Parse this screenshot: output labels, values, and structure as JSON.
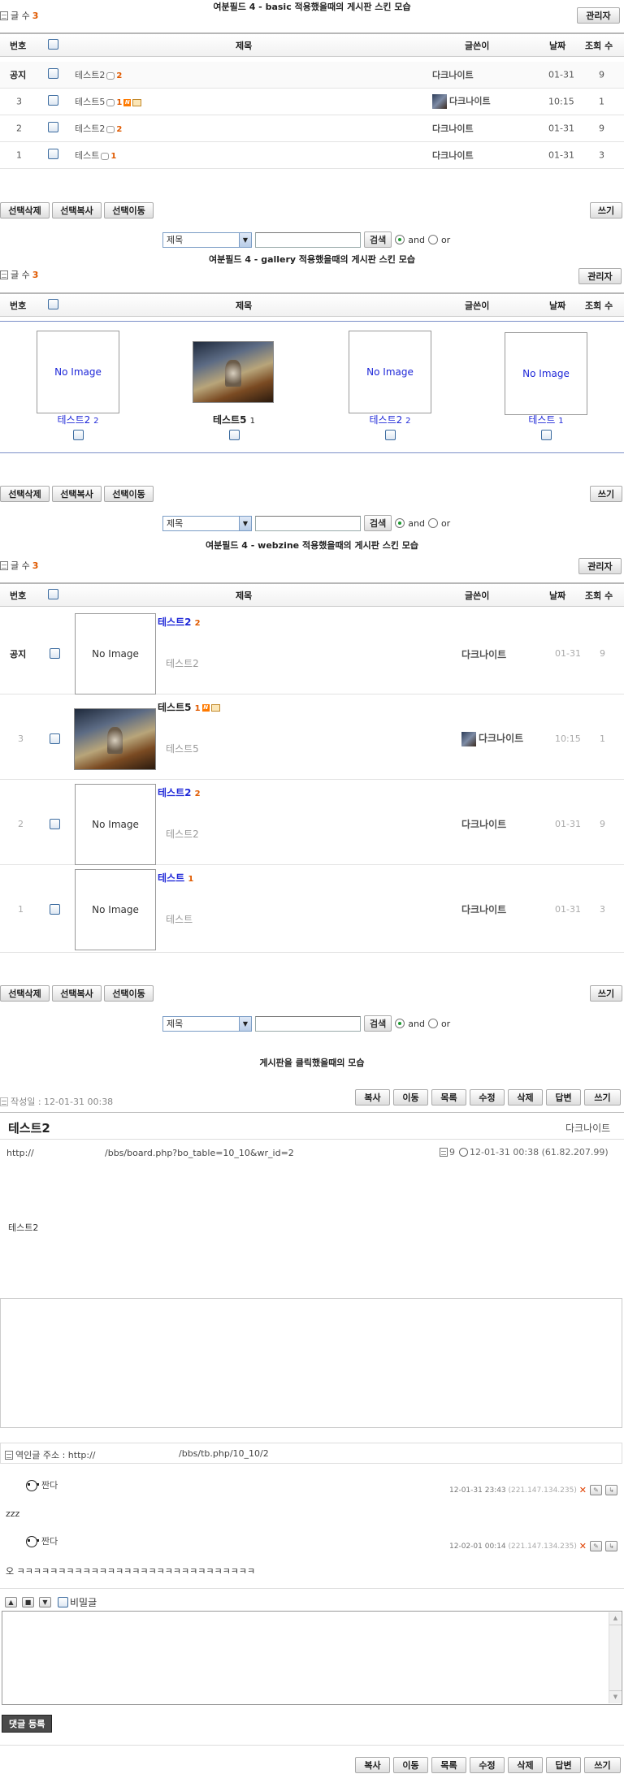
{
  "basic": {
    "title": "여분필드 4 - basic 적용했을때의 게시판 스킨 모습",
    "count_label": "글 수",
    "count": "3",
    "admin_btn": "관리자",
    "headers": {
      "no": "번호",
      "subject": "제목",
      "writer": "글쓴이",
      "date": "날짜",
      "hits": "조회 수"
    },
    "rows": [
      {
        "no": "공지",
        "subject": "테스트2",
        "comments": "2",
        "writer": "다크나이트",
        "date": "01-31",
        "hits": "9"
      },
      {
        "no": "3",
        "subject": "테스트5",
        "comments": "1",
        "writer": "다크나이트",
        "date": "10:15",
        "hits": "1"
      },
      {
        "no": "2",
        "subject": "테스트2",
        "comments": "2",
        "writer": "다크나이트",
        "date": "01-31",
        "hits": "9"
      },
      {
        "no": "1",
        "subject": "테스트",
        "comments": "1",
        "writer": "다크나이트",
        "date": "01-31",
        "hits": "3"
      }
    ]
  },
  "actions": {
    "delete": "선택삭제",
    "copy": "선택복사",
    "move": "선택이동",
    "write": "쓰기"
  },
  "search": {
    "field": "제목",
    "button": "검색",
    "and": "and",
    "or": "or"
  },
  "gallery": {
    "title": "여분필드 4 - gallery 적용했을때의 게시판 스킨 모습",
    "count_label": "글 수",
    "count": "3",
    "admin_btn": "관리자",
    "noimage": "No Image",
    "items": [
      {
        "subject": "테스트2",
        "comments": "2"
      },
      {
        "subject": "테스트5",
        "comments": "1"
      },
      {
        "subject": "테스트2",
        "comments": "2"
      },
      {
        "subject": "테스트",
        "comments": "1"
      }
    ]
  },
  "webzine": {
    "title": "여분필드 4 - webzine 적용했을때의 게시판 스킨 모습",
    "count_label": "글 수",
    "count": "3",
    "admin_btn": "관리자",
    "noimage": "No Image",
    "rows": [
      {
        "no": "공지",
        "subject": "테스트2",
        "comments": "2",
        "body": "테스트2",
        "writer": "다크나이트",
        "date": "01-31",
        "hits": "9"
      },
      {
        "no": "3",
        "subject": "테스트5",
        "comments": "1",
        "body": "테스트5",
        "writer": "다크나이트",
        "date": "10:15",
        "hits": "1"
      },
      {
        "no": "2",
        "subject": "테스트2",
        "comments": "2",
        "body": "테스트2",
        "writer": "다크나이트",
        "date": "01-31",
        "hits": "9"
      },
      {
        "no": "1",
        "subject": "테스트",
        "comments": "1",
        "body": "테스트",
        "writer": "다크나이트",
        "date": "01-31",
        "hits": "3"
      }
    ]
  },
  "view": {
    "title": "게시판을 클릭했을때의 모습",
    "created": "작성일 : 12-01-31 00:38",
    "buttons": [
      "복사",
      "이동",
      "목록",
      "수정",
      "삭제",
      "답변",
      "쓰기"
    ],
    "subject": "테스트2",
    "writer": "다크나이트",
    "link_left": "http://",
    "link_right": "/bbs/board.php?bo_table=10_10&wr_id=2",
    "hits": "9",
    "datetime": "12-01-31 00:38 (61.82.207.99)",
    "body": "테스트2",
    "trackback": "역인글 주소 : http://",
    "trackback_path": "/bbs/tb.php/10_10/2",
    "comments": [
      {
        "name": "짠다",
        "datetime": "12-01-31 23:43",
        "ip": "(221.147.134.235)",
        "text": "zzz"
      },
      {
        "name": "짠다",
        "datetime": "12-02-01 00:14",
        "ip": "(221.147.134.235)",
        "text": "오 ㅋㅋㅋㅋㅋㅋㅋㅋㅋㅋㅋㅋㅋㅋㅋㅋㅋㅋㅋㅋㅋㅋㅋㅋㅋㅋㅋㅋㅋ"
      }
    ],
    "secret_label": "비밀글",
    "submit": "댓글 등록"
  }
}
